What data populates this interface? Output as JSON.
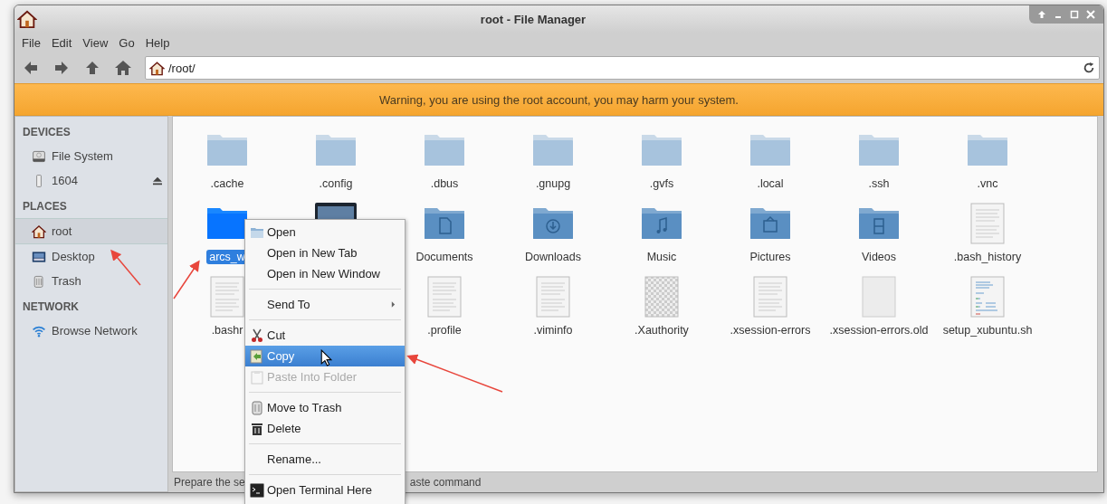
{
  "window": {
    "title": "root - File Manager"
  },
  "menubar": [
    "File",
    "Edit",
    "View",
    "Go",
    "Help"
  ],
  "location": {
    "value": "/root/"
  },
  "warning": "Warning, you are using the root account, you may harm your system.",
  "sidebar": {
    "sections": [
      {
        "title": "DEVICES",
        "items": [
          {
            "label": "File System",
            "kind": "drive",
            "selected": false,
            "eject": false
          },
          {
            "label": "1604",
            "kind": "usb",
            "selected": false,
            "eject": true
          }
        ]
      },
      {
        "title": "PLACES",
        "items": [
          {
            "label": "root",
            "kind": "home",
            "selected": true,
            "eject": false
          },
          {
            "label": "Desktop",
            "kind": "desktop",
            "selected": false,
            "eject": false
          },
          {
            "label": "Trash",
            "kind": "trash",
            "selected": false,
            "eject": false
          }
        ]
      },
      {
        "title": "NETWORK",
        "items": [
          {
            "label": "Browse Network",
            "kind": "network",
            "selected": false,
            "eject": false
          }
        ]
      }
    ]
  },
  "files": [
    [
      {
        "name": ".cache",
        "kind": "folder",
        "selected": false
      },
      {
        "name": ".config",
        "kind": "folder",
        "selected": false
      },
      {
        "name": ".dbus",
        "kind": "folder",
        "selected": false
      },
      {
        "name": ".gnupg",
        "kind": "folder",
        "selected": false
      },
      {
        "name": ".gvfs",
        "kind": "folder",
        "selected": false
      },
      {
        "name": ".local",
        "kind": "folder",
        "selected": false
      },
      {
        "name": ".ssh",
        "kind": "folder",
        "selected": false
      },
      {
        "name": ".vnc",
        "kind": "folder",
        "selected": false
      }
    ],
    [
      {
        "name": "arcs_w",
        "kind": "folder",
        "selected": true
      },
      {
        "kind": "monitor"
      },
      {
        "name": "Documents",
        "kind": "folder-documents",
        "selected": false
      },
      {
        "name": "Downloads",
        "kind": "folder-downloads",
        "selected": false
      },
      {
        "name": "Music",
        "kind": "folder-music",
        "selected": false
      },
      {
        "name": "Pictures",
        "kind": "folder-pictures",
        "selected": false
      },
      {
        "name": "Videos",
        "kind": "folder-videos",
        "selected": false
      },
      {
        "name": ".bash_history",
        "kind": "text",
        "selected": false
      }
    ],
    [
      {
        "name": ".bashr",
        "kind": "text",
        "selected": false
      },
      {
        "kind": "covered"
      },
      {
        "name": ".profile",
        "kind": "text",
        "selected": false
      },
      {
        "name": ".viminfo",
        "kind": "text",
        "selected": false
      },
      {
        "name": ".Xauthority",
        "kind": "image",
        "selected": false
      },
      {
        "name": ".xsession-errors",
        "kind": "text",
        "selected": false
      },
      {
        "name": ".xsession-errors.old",
        "kind": "empty",
        "selected": false
      },
      {
        "name": "setup_xubuntu.sh",
        "kind": "script",
        "selected": false
      }
    ]
  ],
  "status_bar": [
    "Prepare the se",
    "aste command"
  ],
  "context_menu": [
    {
      "label": "Open",
      "kind": "item",
      "selected": false,
      "disabled": false
    },
    {
      "label": "Open in New Tab",
      "kind": "item",
      "selected": false,
      "disabled": false
    },
    {
      "label": "Open in New Window",
      "kind": "item",
      "selected": false,
      "disabled": false
    },
    {
      "kind": "separator"
    },
    {
      "label": "Send To",
      "kind": "submenu",
      "selected": false,
      "disabled": false
    },
    {
      "kind": "separator"
    },
    {
      "label": "Cut",
      "kind": "item",
      "selected": false,
      "disabled": false
    },
    {
      "label": "Copy",
      "kind": "item",
      "selected": true,
      "disabled": false
    },
    {
      "label": "Paste Into Folder",
      "kind": "item",
      "selected": false,
      "disabled": true
    },
    {
      "kind": "separator"
    },
    {
      "label": "Move to Trash",
      "kind": "item",
      "selected": false,
      "disabled": false
    },
    {
      "label": "Delete",
      "kind": "item",
      "selected": false,
      "disabled": false
    },
    {
      "kind": "separator"
    },
    {
      "label": "Rename...",
      "kind": "item",
      "selected": false,
      "disabled": false
    },
    {
      "kind": "separator"
    },
    {
      "label": "Open Terminal Here",
      "kind": "item",
      "selected": false,
      "disabled": false
    }
  ]
}
